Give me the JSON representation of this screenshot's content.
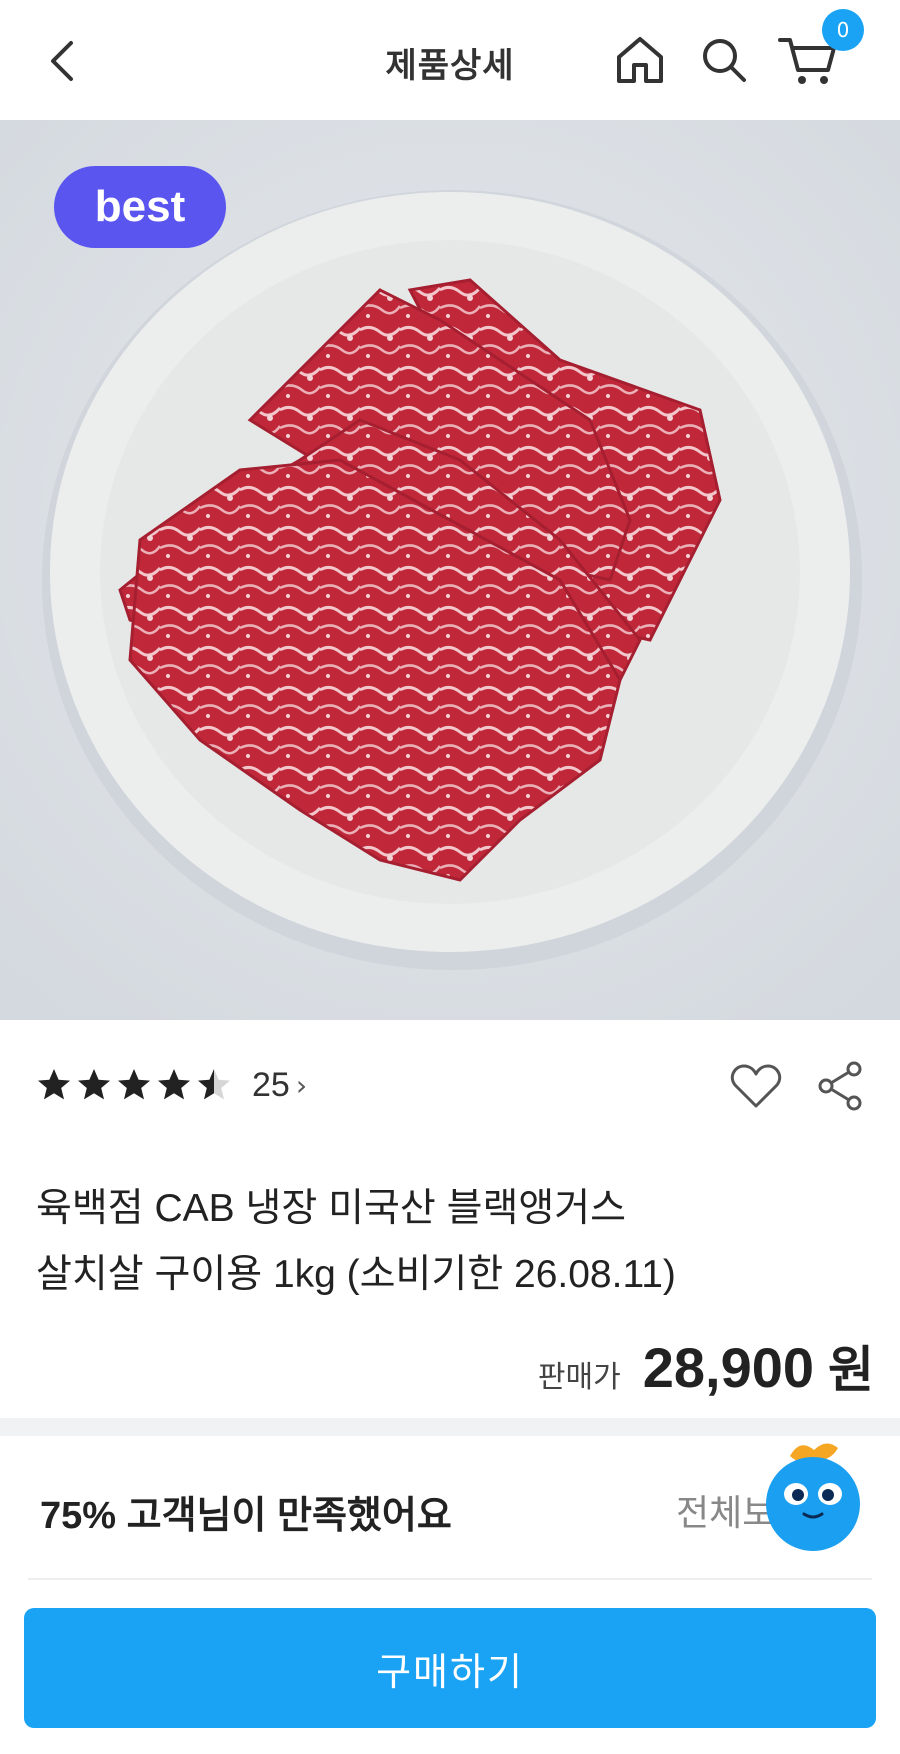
{
  "header": {
    "title": "제품상세",
    "back_icon": "chevron-left-icon",
    "home_icon": "home-icon",
    "search_icon": "search-icon",
    "cart_icon": "cart-icon",
    "cart_count": "0"
  },
  "hero": {
    "badge": "best"
  },
  "rating": {
    "value": 4.5,
    "max": 5,
    "count": "25",
    "chevron": "›"
  },
  "actions": {
    "wishlist_icon": "heart-icon",
    "share_icon": "share-icon"
  },
  "product": {
    "title_line1": "육백점 CAB 냉장 미국산 블랙앵거스",
    "title_line2": "살치살 구이용 1kg (소비기한 26.08.11)",
    "price_label": "판매가",
    "price": "28,900",
    "price_unit": "원"
  },
  "reviews": {
    "satisfaction": "75% 고객님이 만족했어요",
    "see_all": "전체보기"
  },
  "cta": {
    "buy_label": "구매하기"
  },
  "colors": {
    "accent": "#1aa3f5",
    "badge": "#5b55f0"
  }
}
